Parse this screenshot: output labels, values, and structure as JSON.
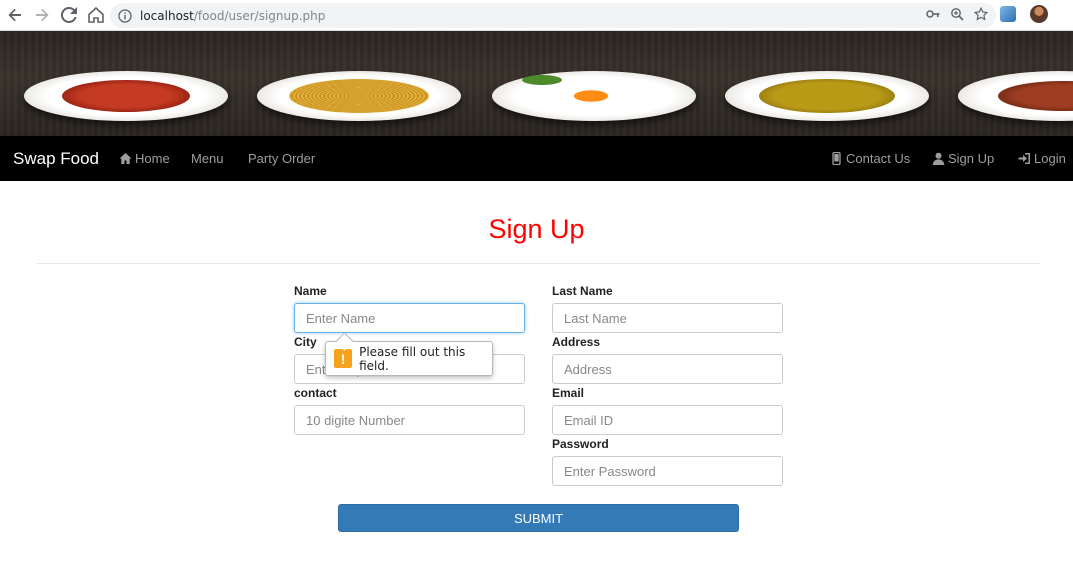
{
  "browser": {
    "url_host": "localhost",
    "url_path": "/food/user/signup.php"
  },
  "navbar": {
    "brand": "Swap Food",
    "items": [
      {
        "label": "Home",
        "icon": "home-icon"
      },
      {
        "label": "Menu"
      },
      {
        "label": "Party Order"
      }
    ],
    "right_items": [
      {
        "label": "Contact Us",
        "icon": "phone-icon"
      },
      {
        "label": "Sign Up",
        "icon": "user-icon"
      },
      {
        "label": "Login",
        "icon": "login-icon"
      }
    ]
  },
  "page": {
    "title": "Sign Up"
  },
  "form": {
    "name": {
      "label": "Name",
      "placeholder": "Enter Name"
    },
    "last_name": {
      "label": "Last Name",
      "placeholder": "Last Name"
    },
    "city": {
      "label": "City",
      "placeholder": "Enter City"
    },
    "address": {
      "label": "Address",
      "placeholder": "Address"
    },
    "contact": {
      "label": "contact",
      "placeholder": "10 digite Number"
    },
    "email": {
      "label": "Email",
      "placeholder": "Email ID"
    },
    "password": {
      "label": "Password",
      "placeholder": "Enter Password"
    },
    "submit_label": "SUBMIT"
  },
  "validation": {
    "message": "Please fill out this field.",
    "icon": "warning-icon"
  },
  "colors": {
    "title": "#ff0000",
    "navbar_bg": "#000000",
    "submit_bg": "#337ab7"
  }
}
